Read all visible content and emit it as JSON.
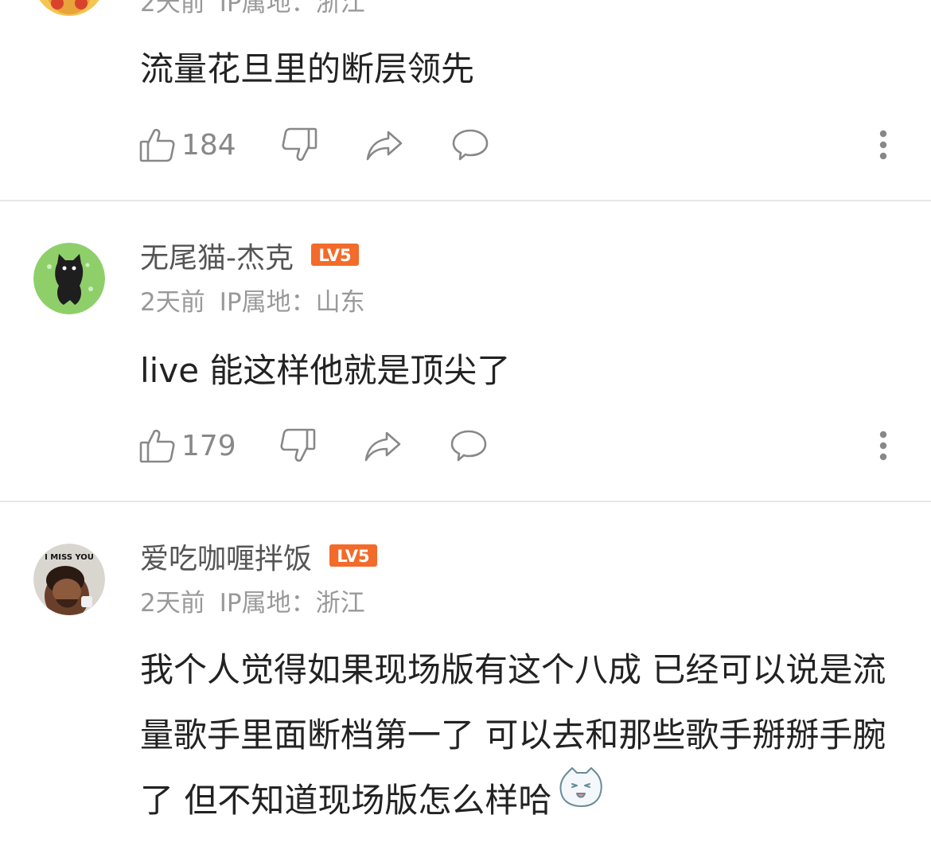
{
  "colors": {
    "badge": "#f26b2a",
    "meta_text": "#999999",
    "icon": "#888888"
  },
  "comments": [
    {
      "meta": {
        "time": "2天前",
        "ip_label": "IP属地：",
        "location": "浙江"
      },
      "text": "流量花旦里的断层领先",
      "likes": "184"
    },
    {
      "username": "无尾猫-杰克",
      "level": "LV5",
      "meta": {
        "time": "2天前",
        "ip_label": "IP属地：",
        "location": "山东"
      },
      "text": "live 能这样他就是顶尖了",
      "likes": "179",
      "avatar_icon": "black-cat-avatar"
    },
    {
      "username": "爱吃咖喱拌饭",
      "level": "LV5",
      "avatar_text": "I MISS YOU",
      "meta": {
        "time": "2天前",
        "ip_label": "IP属地：",
        "location": "浙江"
      },
      "text": "我个人觉得如果现场版有这个八成 已经可以说是流量歌手里面断档第一了 可以去和那些歌手掰掰手腕了 但不知道现场版怎么样哈",
      "emoji": "sticker-emoji-icon"
    }
  ]
}
